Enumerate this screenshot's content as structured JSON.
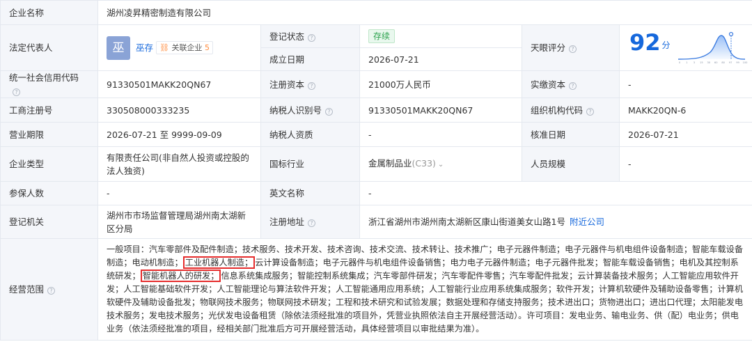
{
  "labels": {
    "company_name": "企业名称",
    "legal_rep": "法定代表人",
    "reg_status": "登记状态",
    "established": "成立日期",
    "tianyan_score": "天眼评分",
    "credit_code": "统一社会信用代码",
    "reg_capital": "注册资本",
    "paid_capital": "实缴资本",
    "reg_number": "工商注册号",
    "taxpayer_id": "纳税人识别号",
    "org_code": "组织机构代码",
    "term": "营业期限",
    "taxpayer_qual": "纳税人资质",
    "approval_date": "核准日期",
    "company_type": "企业类型",
    "industry": "国标行业",
    "staff_size": "人员规模",
    "insured": "参保人数",
    "english_name": "英文名称",
    "reg_authority": "登记机关",
    "reg_address": "注册地址",
    "scope": "经营范围"
  },
  "values": {
    "company_name": "湖州凌昇精密制造有限公司",
    "legal_avatar": "巫",
    "legal_name": "巫存",
    "related_icon": "⛓",
    "related_label": "关联企业",
    "related_count": "5",
    "reg_status": "存续",
    "established": "2026-07-21",
    "score": "92",
    "score_unit": "分",
    "credit_code": "91330501MAKK20QN67",
    "reg_capital": "21000万人民币",
    "paid_capital": "-",
    "reg_number": "330508000333235",
    "taxpayer_id": "91330501MAKK20QN67",
    "org_code": "MAKK20QN-6",
    "term": "2026-07-21 至 9999-09-09",
    "taxpayer_qual": "-",
    "approval_date": "2026-07-21",
    "company_type": "有限责任公司(非自然人投资或控股的法人独资)",
    "industry": "金属制品业",
    "industry_code": "(C33)",
    "staff_size": "-",
    "insured": "-",
    "english_name": "-",
    "reg_authority": "湖州市市场监督管理局湖州南太湖新区分局",
    "reg_address": "浙江省湖州市湖州南太湖新区康山街道美女山路1号",
    "nearby_link": "附近公司",
    "scope_parts": [
      "一般项目：汽车零部件及配件制造；技术服务、技术开发、技术咨询、技术交流、技术转让、技术推广；电子元器件制造；电子元器件与机电组件设备制造；智能车载设备制造；电动机制造；",
      "工业机器人制造；",
      "云计算设备制造；电子元器件与机电组件设备销售；电力电子元器件制造；电子元器件批发；智能车载设备销售；电机及其控制系统研发；",
      "智能机器人的研发；",
      "信息系统集成服务；智能控制系统集成；汽车零部件研发；汽车零配件零售；汽车零配件批发；云计算装备技术服务；人工智能应用软件开发；人工智能基础软件开发；人工智能理论与算法软件开发；人工智能通用应用系统；人工智能行业应用系统集成服务；软件开发；计算机软硬件及辅助设备零售；计算机软硬件及辅助设备批发；物联网技术服务；物联网技术研发；工程和技术研究和试验发展；数据处理和存储支持服务；技术进出口；货物进出口；进出口代理；太阳能发电技术服务；发电技术服务；光伏发电设备租赁（除依法须经批准的项目外，凭营业执照依法自主开展经营活动）。许可项目：发电业务、输电业务、供（配）电业务；供电业务（依法须经批准的项目，经相关部门批准后方可开展经营活动，具体经营项目以审批结果为准）。"
    ]
  },
  "score_chart": {
    "ticks": [
      "0",
      "1",
      "3",
      "15",
      "30",
      "60",
      "80",
      "97",
      "99",
      "100"
    ]
  },
  "colors": {
    "accent": "#1668dc",
    "highlight": "#e52b2b",
    "label_bg": "#f4f6fa",
    "status_green": "#2ca24d"
  }
}
